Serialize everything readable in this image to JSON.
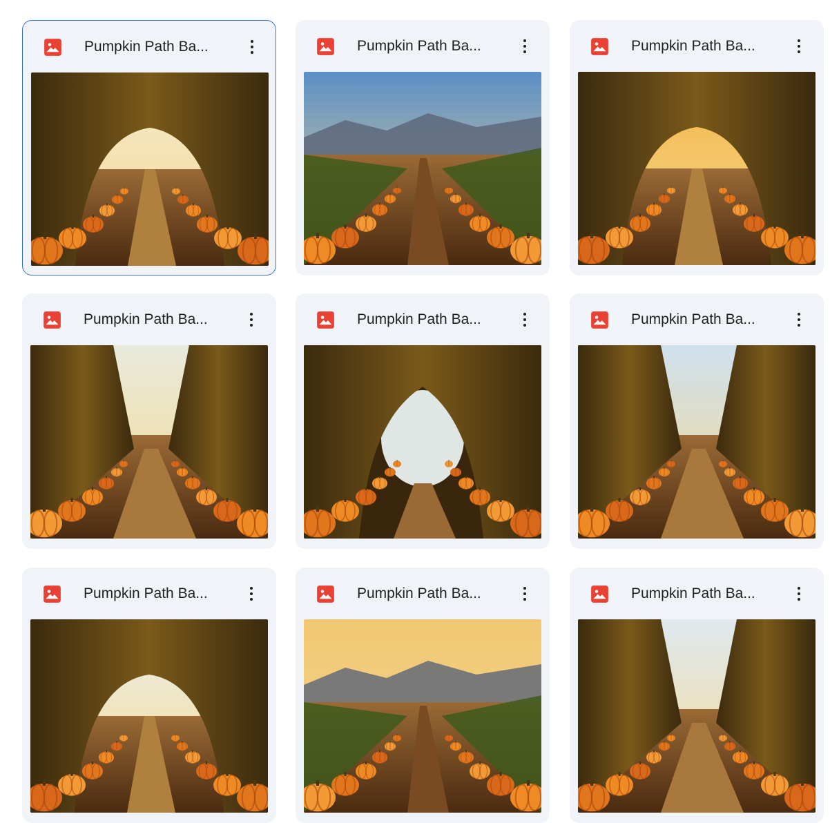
{
  "grid": {
    "cards": [
      {
        "title": "Pumpkin Path Ba...",
        "selected": true,
        "variant": "arch",
        "sky": "#f4ead0"
      },
      {
        "title": "Pumpkin Path Ba...",
        "selected": false,
        "variant": "field",
        "sky": "#5b8fc7"
      },
      {
        "title": "Pumpkin Path Ba...",
        "selected": false,
        "variant": "arch",
        "sky": "#f2b548"
      },
      {
        "title": "Pumpkin Path Ba...",
        "selected": false,
        "variant": "path",
        "sky": "#e8eadc"
      },
      {
        "title": "Pumpkin Path Ba...",
        "selected": false,
        "variant": "tunnel",
        "sky": "#dfe6e4"
      },
      {
        "title": "Pumpkin Path Ba...",
        "selected": false,
        "variant": "path",
        "sky": "#cfe0ee"
      },
      {
        "title": "Pumpkin Path Ba...",
        "selected": false,
        "variant": "arch",
        "sky": "#eaf0ee"
      },
      {
        "title": "Pumpkin Path Ba...",
        "selected": false,
        "variant": "field",
        "sky": "#f1c774"
      },
      {
        "title": "Pumpkin Path Ba...",
        "selected": false,
        "variant": "path",
        "sky": "#dfe9ef"
      }
    ]
  },
  "file_icon": "image-file-icon",
  "more_icon": "more-vert-icon",
  "colors": {
    "accent_selected": "#2f6fd6",
    "card_bg": "#f0f4f9",
    "image_icon_red": "#e94235"
  }
}
